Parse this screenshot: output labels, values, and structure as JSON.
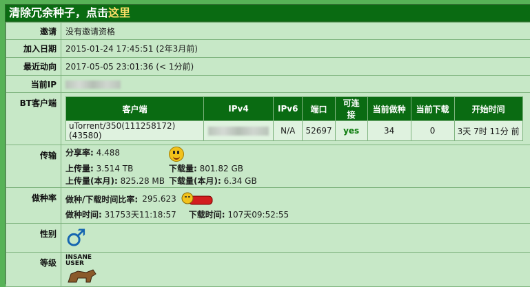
{
  "title": {
    "prefix": "清除冗余种子，点击",
    "link": "这里"
  },
  "rows": {
    "invite": {
      "label": "邀请",
      "value": "没有邀请资格"
    },
    "join": {
      "label": "加入日期",
      "value": "2015-01-24 17:45:51 (2年3月前)"
    },
    "recent": {
      "label": "最近动向",
      "value": "2017-05-05 23:01:36 (< 1分前)"
    },
    "ip": {
      "label": "当前IP"
    },
    "bt": {
      "label": "BT客户端"
    },
    "transfer": {
      "label": "传输"
    },
    "seeding": {
      "label": "做种率"
    },
    "gender": {
      "label": "性别"
    },
    "level": {
      "label": "等级"
    }
  },
  "client_table": {
    "headers": [
      "客户端",
      "IPv4",
      "IPv6",
      "端口",
      "可连接",
      "当前做种",
      "当前下载",
      "开始时间"
    ],
    "row": {
      "client": "uTorrent/350(111258172)(43580)",
      "ipv6": "N/A",
      "port": "52697",
      "connectable": "yes",
      "seeding": "34",
      "downloading": "0",
      "start": "3天 7时 11分 前"
    }
  },
  "transfer": {
    "ratio_label": "分享率:",
    "ratio": "4.488",
    "uploaded_label": "上传量:",
    "uploaded": "3.514 TB",
    "downloaded_label": "下载量:",
    "downloaded": "801.82 GB",
    "up_month_label": "上传量(本月):",
    "up_month": "825.28 MB",
    "down_month_label": "下载量(本月):",
    "down_month": "6.34 GB"
  },
  "seeding": {
    "ratio_label": "做种/下载时间比率:",
    "ratio": "295.623",
    "seed_time_label": "做种时间:",
    "seed_time": "31753天11:18:57",
    "dl_time_label": "下载时间:",
    "dl_time": "107天09:52:55"
  },
  "gender": {
    "symbol": "♂"
  },
  "level": {
    "badge": "INSANE USER"
  },
  "colors": {
    "header": "#0a6b12",
    "background": "#c7e8c7",
    "border": "#57b257",
    "link": "#ffe06a",
    "gender": "#1565b0"
  },
  "icons": {
    "smiley": "smiley-icon",
    "sleeping": "sleeping-icon",
    "gender": "male-icon",
    "level": "insane-user-badge-icon"
  }
}
